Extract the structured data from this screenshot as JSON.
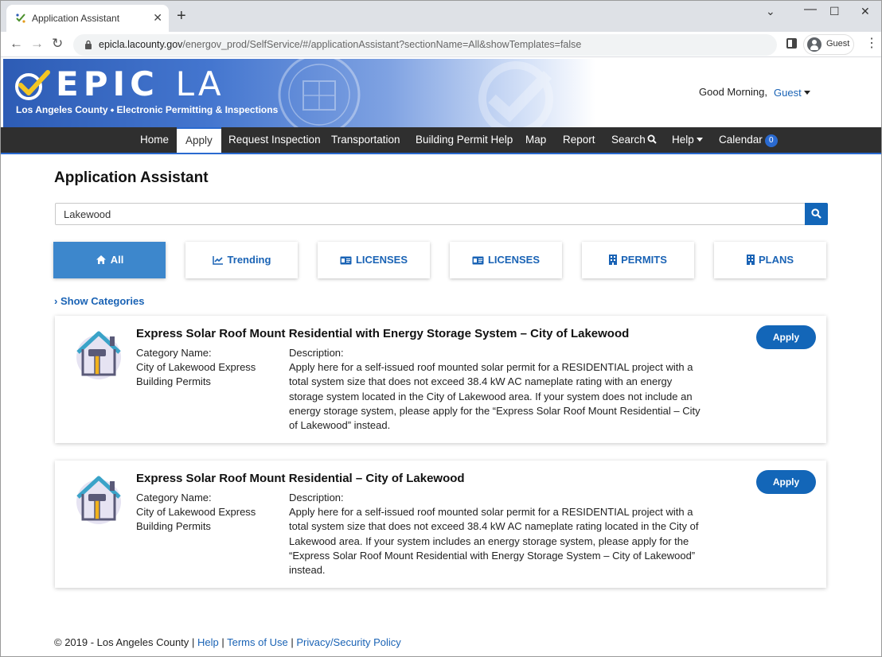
{
  "browser": {
    "tab_title": "Application Assistant",
    "tab_close": "✕",
    "new_tab": "+",
    "url_host": "epicla.lacounty.gov",
    "url_path": "/energov_prod/SelfService/#/applicationAssistant?sectionName=All&showTemplates=false",
    "profile": "Guest",
    "back": "←",
    "forward": "→",
    "reload": "↻",
    "minimize": "⌄",
    "restore": "☐",
    "close": "✕",
    "menu": "⋮"
  },
  "header": {
    "logo_main": "EPIC",
    "logo_la": "LA",
    "logo_subtitle": "Los Angeles County ⬩ Electronic Permitting & Inspections",
    "greeting": "Good Morning,",
    "user": "Guest"
  },
  "nav": {
    "items": [
      {
        "label": "Home"
      },
      {
        "label": "Apply"
      },
      {
        "label": "Request Inspection"
      },
      {
        "label": "Transportation"
      },
      {
        "label": "Building Permit Help"
      },
      {
        "label": "Map"
      },
      {
        "label": "Report"
      },
      {
        "label": "Search"
      },
      {
        "label": "Help"
      },
      {
        "label": "Calendar"
      }
    ],
    "calendar_badge": "0"
  },
  "main": {
    "title": "Application Assistant",
    "search_value": "Lakewood",
    "filters": [
      {
        "label": "All",
        "icon": "home-icon"
      },
      {
        "label": "Trending",
        "icon": "line-chart-icon"
      },
      {
        "label": "LICENSES",
        "icon": "id-card-icon"
      },
      {
        "label": "LICENSES",
        "icon": "id-card-icon"
      },
      {
        "label": "PERMITS",
        "icon": "building-icon"
      },
      {
        "label": "PLANS",
        "icon": "building-icon"
      }
    ],
    "show_categories": "Show Categories",
    "results": [
      {
        "title": "Express Solar Roof Mount Residential with Energy Storage System – City of Lakewood",
        "category_label": "Category Name:",
        "category_line1": "City of Lakewood Express",
        "category_line2": "Building Permits",
        "description_label": "Description:",
        "description": [
          "Apply here for a self-issued roof mounted solar permit for a RESIDENTIAL project with a",
          "total system size that does not exceed 38.4 kW AC nameplate rating with an energy",
          "storage system located in the City of Lakewood area. If your system does not include an",
          "energy storage system, please apply for the “Express Solar Roof Mount Residential – City",
          "of Lakewood” instead."
        ],
        "apply": "Apply"
      },
      {
        "title": "Express Solar Roof Mount Residential – City of Lakewood",
        "category_label": "Category Name:",
        "category_line1": "City of Lakewood Express",
        "category_line2": "Building Permits",
        "description_label": "Description:",
        "description": [
          "Apply here for a self-issued roof mounted solar permit for a RESIDENTIAL project with a",
          "total system size that does not exceed 38.4 kW AC nameplate rating located in the City of",
          "Lakewood area. If your system includes an energy storage system, please apply for the",
          "“Express Solar Roof Mount Residential with Energy Storage System – City of Lakewood”",
          "instead."
        ],
        "apply": "Apply"
      }
    ]
  },
  "footer": {
    "copyright": "© 2019 - Los Angeles County",
    "sep": "|",
    "help": "Help",
    "terms": "Terms of Use",
    "privacy": "Privacy/Security Policy"
  },
  "colors": {
    "primary": "#1366b8",
    "nav_bg": "#2f2f2f",
    "active_filter": "#3d87cc",
    "link": "#1a63b5"
  }
}
